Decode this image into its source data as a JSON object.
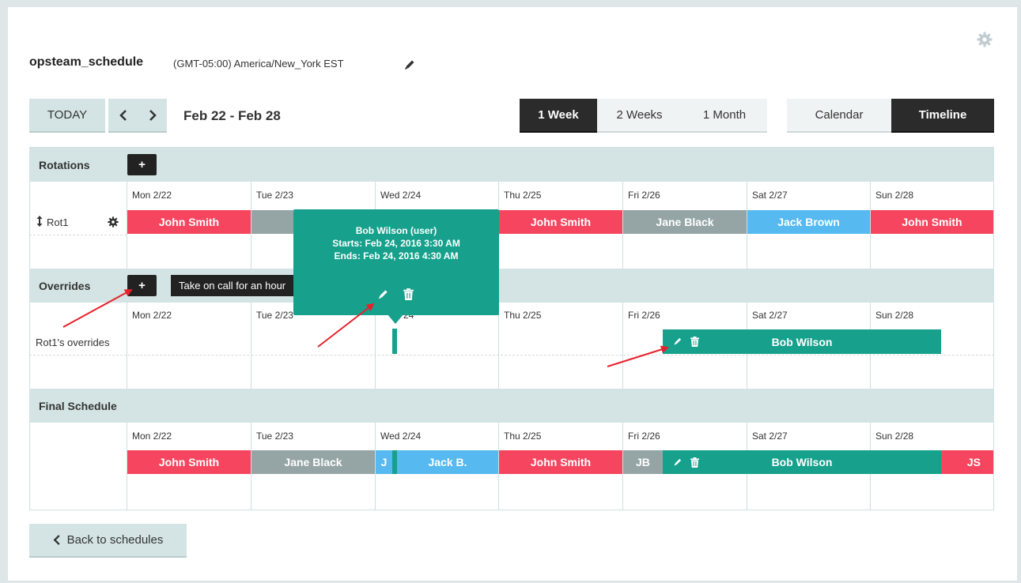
{
  "header": {
    "schedule_name": "opsteam_schedule",
    "timezone": "(GMT-05:00) America/New_York EST"
  },
  "toolbar": {
    "today": "TODAY",
    "prev": "‹",
    "next": "›",
    "date_range": "Feb 22 - Feb 28",
    "ranges": [
      "1 Week",
      "2 Weeks",
      "1 Month"
    ],
    "active_range": "1 Week",
    "views": [
      "Calendar",
      "Timeline"
    ],
    "active_view": "Timeline"
  },
  "days": [
    "Mon 2/22",
    "Tue 2/23",
    "Wed 2/24",
    "Thu 2/25",
    "Fri 2/26",
    "Sat 2/27",
    "Sun 2/28"
  ],
  "rotations": {
    "title": "Rotations",
    "add": "+",
    "row_label": "Rot1",
    "shifts": [
      {
        "name": "John Smith",
        "color": "#f6465f"
      },
      {
        "name": "Ja",
        "color": "#95a5a6"
      },
      {
        "name": "",
        "color": "#56b9f0"
      },
      {
        "name": "John Smith",
        "color": "#f6465f"
      },
      {
        "name": "Jane Black",
        "color": "#95a5a6"
      },
      {
        "name": "Jack Brown",
        "color": "#56b9f0"
      },
      {
        "name": "John Smith",
        "color": "#f6465f"
      }
    ]
  },
  "overrides": {
    "title": "Overrides",
    "add": "+",
    "hint": "Take on call for an hour",
    "row_label": "Rot1's overrides",
    "bar_name": "Bob Wilson",
    "tail_day": "24"
  },
  "tooltip": {
    "line1": "Bob Wilson  (user)",
    "line2": "Starts: Feb 24, 2016 3:30 AM",
    "line3": "Ends: Feb 24, 2016 4:30 AM"
  },
  "final": {
    "title": "Final Schedule",
    "bars": {
      "b1": "John Smith",
      "b2": "Jane Black",
      "b3": "J",
      "b4": "Jack B.",
      "b5": "John Smith",
      "b6": "JB",
      "b7": "Bob Wilson",
      "b8": "JS"
    }
  },
  "footer": {
    "back": "Back to schedules"
  },
  "colors": {
    "red": "#f6465f",
    "gray": "#95a5a6",
    "blue": "#56b9f0",
    "teal": "#17a08c",
    "dark": "#2b2b2b",
    "header_bg": "#d4e4e4"
  }
}
